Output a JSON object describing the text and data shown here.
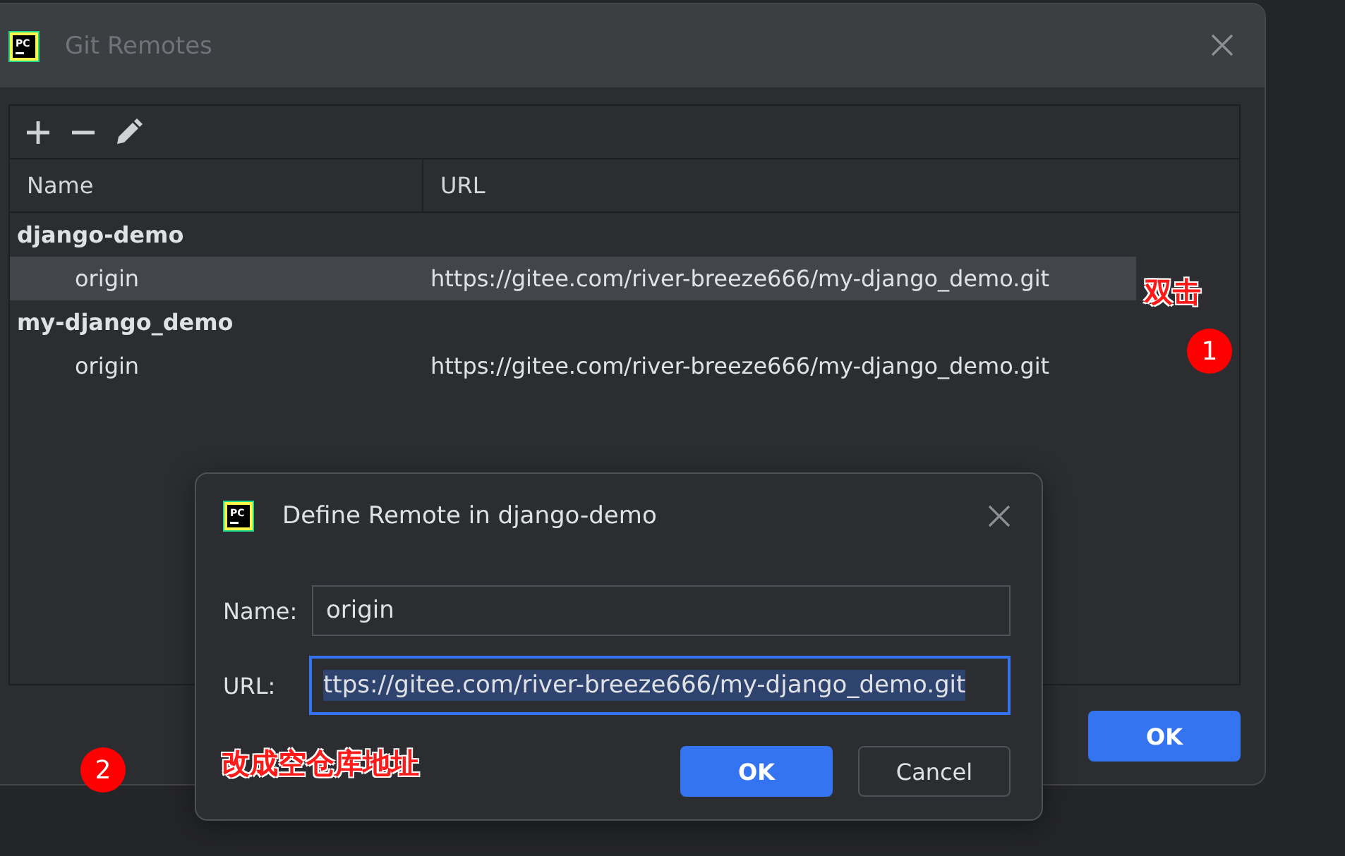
{
  "window": {
    "logo": "PC",
    "title": "Git Remotes"
  },
  "table": {
    "columns": [
      "Name",
      "URL"
    ],
    "groups": [
      {
        "name": "django-demo",
        "remotes": [
          {
            "name": "origin",
            "url": "https://gitee.com/river-breeze666/my-django_demo.git",
            "selected": true
          }
        ]
      },
      {
        "name": "my-django_demo",
        "remotes": [
          {
            "name": "origin",
            "url": "https://gitee.com/river-breeze666/my-django_demo.git",
            "selected": false
          }
        ]
      }
    ]
  },
  "ok_button": "OK",
  "dialog": {
    "logo": "PC",
    "title": "Define Remote in django-demo",
    "fields": [
      {
        "label": "Name:",
        "value": "origin",
        "focused": false
      },
      {
        "label": "URL:",
        "value": "ttps://gitee.com/river-breeze666/my-django_demo.git",
        "focused": true
      }
    ],
    "buttons": [
      {
        "label": "OK",
        "kind": "primary"
      },
      {
        "label": "Cancel",
        "kind": "secondary"
      }
    ]
  },
  "annotations": [
    {
      "kind": "note",
      "text": "双击"
    },
    {
      "kind": "badge",
      "text": "1"
    },
    {
      "kind": "badge",
      "text": "2"
    },
    {
      "kind": "note",
      "text": "改成空仓库地址"
    }
  ]
}
